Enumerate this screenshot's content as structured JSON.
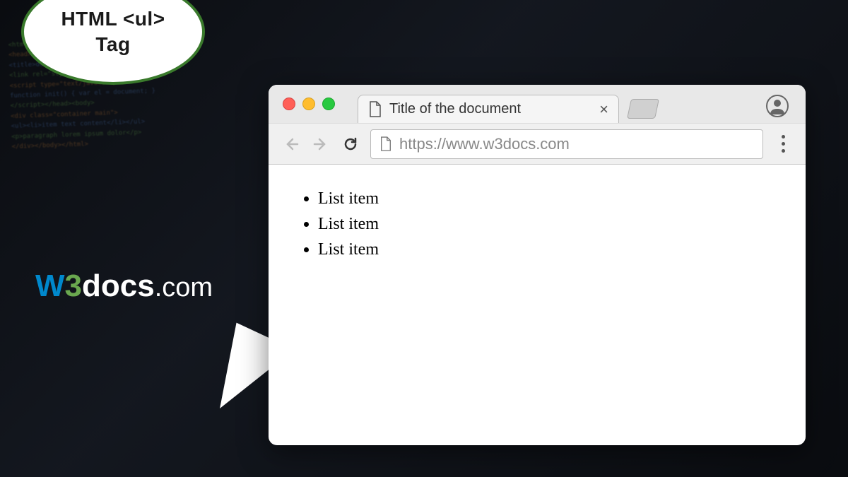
{
  "badge": {
    "line1": "HTML <ul>",
    "line2": "Tag"
  },
  "logo": {
    "w": "W",
    "three": "3",
    "docs": "docs",
    "com": ".com"
  },
  "browser": {
    "tab_title": "Title of the document",
    "url": "https://www.w3docs.com"
  },
  "content": {
    "list_items": [
      "List item",
      "List item",
      "List item"
    ]
  }
}
